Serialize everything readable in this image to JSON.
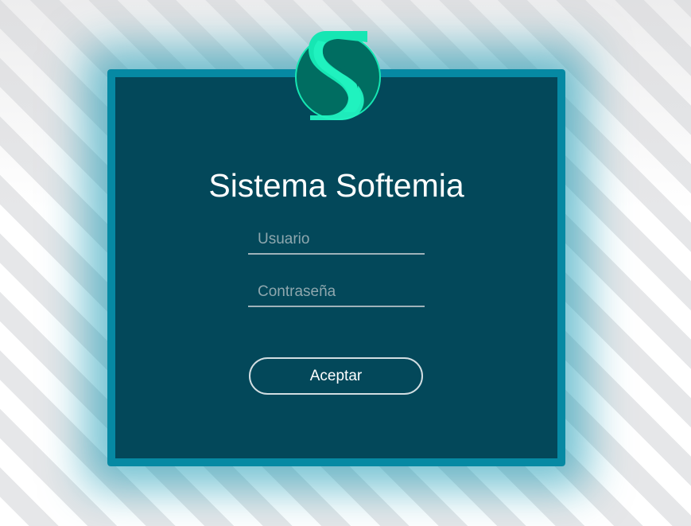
{
  "app": {
    "title": "Sistema Softemia",
    "logo_icon": "softemia-s-logo-icon"
  },
  "login_form": {
    "username_placeholder": "Usuario",
    "password_placeholder": "Contraseña",
    "username_value": "",
    "password_value": "",
    "submit_label": "Aceptar"
  },
  "colors": {
    "card_frame": "#0689a3",
    "card_panel": "#03485a",
    "logo_circle": "#006d61",
    "logo_accent": "#16e6b3",
    "text": "#ffffff"
  }
}
